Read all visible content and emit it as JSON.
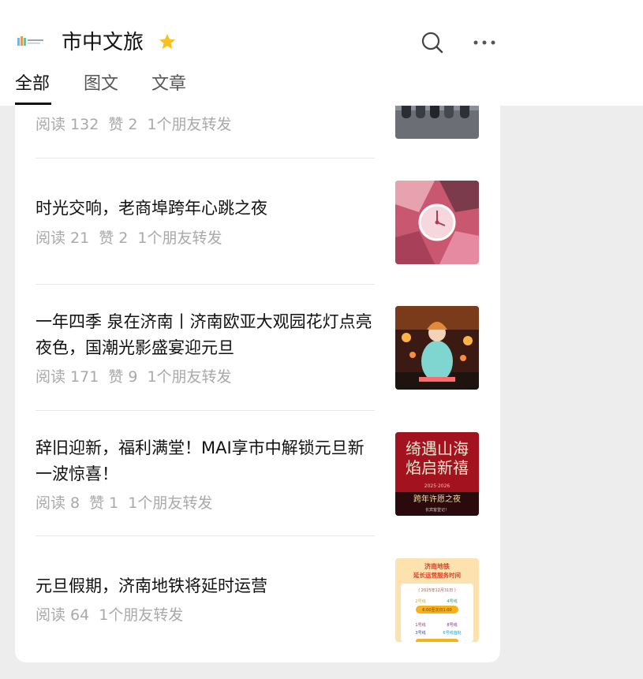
{
  "header": {
    "account_name": "市中文旅",
    "tabs": [
      {
        "label": "全部",
        "active": true
      },
      {
        "label": "图文",
        "active": false
      },
      {
        "label": "文章",
        "active": false
      }
    ]
  },
  "articles": [
    {
      "title": "",
      "reads": "阅读 132",
      "likes": "赞 2",
      "shares": "1个朋友转发",
      "thumb": "people-walking-street-thumbnail"
    },
    {
      "title": "时光交响，老商埠跨年心跳之夜",
      "reads": "阅读 21",
      "likes": "赞 2",
      "shares": "1个朋友转发",
      "thumb": "clock-collage-thumbnail"
    },
    {
      "title": "一年四季 泉在济南丨济南欧亚大观园花灯点亮夜色，国潮光影盛宴迎元旦",
      "reads": "阅读 171",
      "likes": "赞 9",
      "shares": "1个朋友转发",
      "thumb": "lantern-festival-thumbnail"
    },
    {
      "title": "辞旧迎新，福利满堂！MAI享市中解锁元旦新一波惊喜！",
      "reads": "阅读 8",
      "likes": "赞 1",
      "shares": "1个朋友转发",
      "thumb": "red-poster-thumbnail"
    },
    {
      "title": "元旦假期，济南地铁将延时运营",
      "reads": "阅读 64",
      "likes": "",
      "shares": "1个朋友转发",
      "thumb": "metro-schedule-thumbnail"
    }
  ],
  "thumb_texts": {
    "poster_line1": "绮遇山海",
    "poster_line2": "焰启新禧",
    "poster_year": "2025·2026",
    "poster_banner": "跨年许愿之夜",
    "poster_small": "长宾客登记！",
    "metro_title": "济南地铁",
    "metro_subtitle": "延长运营服务时间",
    "metro_date": "( 2025年12月31日 )",
    "metro_line2": "2号线",
    "metro_line4": "4号线",
    "metro_time": "6:00至次日1:00",
    "metro_line1": "1号线",
    "metro_line8": "8号线",
    "metro_line3": "3号线",
    "metro_line6": "6号线首批"
  },
  "colors": {
    "accent_star": "#f7c21d",
    "text_primary": "#111111",
    "text_meta": "#a9a9a9",
    "background": "#ededed"
  },
  "icons": [
    "logo",
    "star-icon",
    "search-icon",
    "more-icon"
  ]
}
